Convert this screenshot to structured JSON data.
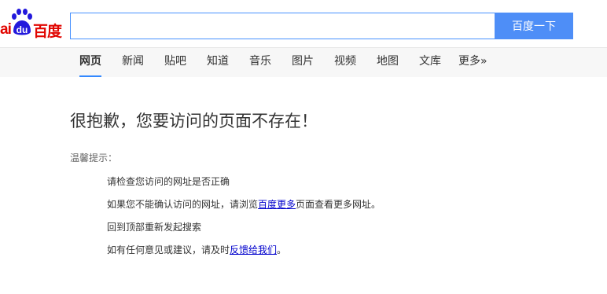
{
  "logo": {
    "prefix": "ai",
    "paw": "du",
    "text": "百度",
    "brand_color": "#e10601",
    "paw_color": "#2319dc"
  },
  "search": {
    "value": "",
    "placeholder": "",
    "button_label": "百度一下",
    "button_color": "#4e8ef7",
    "border_color": "#4791ff"
  },
  "nav": {
    "items": [
      {
        "label": "网页",
        "active": true
      },
      {
        "label": "新闻"
      },
      {
        "label": "贴吧"
      },
      {
        "label": "知道"
      },
      {
        "label": "音乐"
      },
      {
        "label": "图片"
      },
      {
        "label": "视频"
      },
      {
        "label": "地图"
      },
      {
        "label": "文库"
      },
      {
        "label": "更多»"
      }
    ],
    "active_underline_color": "#3388ff"
  },
  "error": {
    "title": "很抱歉，您要访问的页面不存在！",
    "tips_label": "温馨提示：",
    "tips": {
      "t1": "请检查您访问的网址是否正确",
      "t2_before": "如果您不能确认访问的网址，请浏览",
      "t2_link": "百度更多",
      "t2_after": "页面查看更多网址。",
      "t3": "回到顶部重新发起搜索",
      "t4_before": "如有任何意见或建议，请及时",
      "t4_link": "反馈给我们",
      "t4_after": "。"
    },
    "link_color": "#0000cc"
  }
}
